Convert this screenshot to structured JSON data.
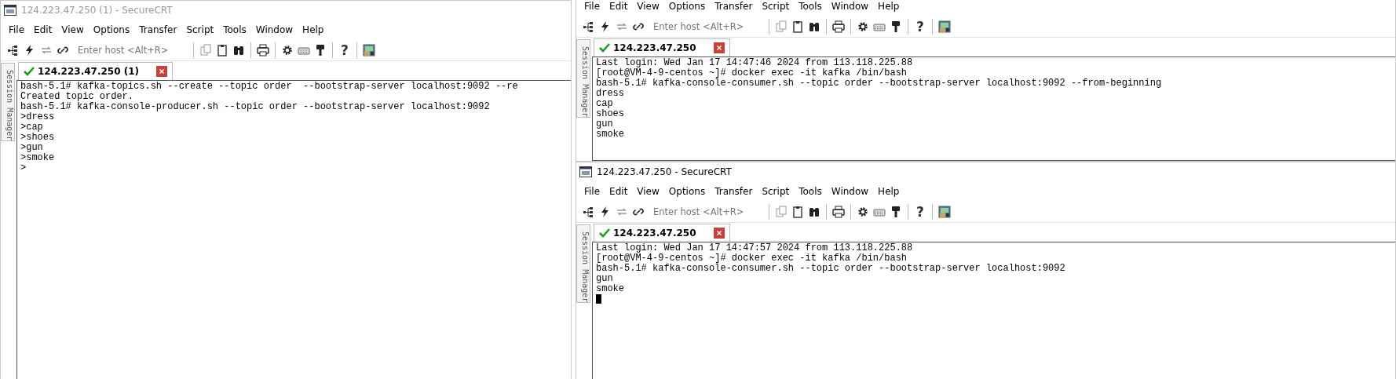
{
  "windows": [
    {
      "title": "124.223.47.250 (1) - SecureCRT",
      "active": false,
      "menu": [
        "File",
        "Edit",
        "View",
        "Options",
        "Transfer",
        "Script",
        "Tools",
        "Window",
        "Help"
      ],
      "toolbar": {
        "host_placeholder": "Enter host <Alt+R>",
        "help_label": "?"
      },
      "side_tab": "Session Manager",
      "tabs": [
        {
          "label": "124.223.47.250 (1)",
          "selected": true,
          "connected": true
        }
      ],
      "terminal": {
        "cursor": false,
        "lines": [
          "bash-5.1# kafka-topics.sh --create --topic order  --bootstrap-server localhost:9092 --re",
          "Created topic order.",
          "bash-5.1# kafka-console-producer.sh --topic order --bootstrap-server localhost:9092",
          ">dress",
          ">cap",
          ">shoes",
          ">gun",
          ">smoke",
          ">"
        ]
      }
    },
    {
      "menu": [
        "File",
        "Edit",
        "View",
        "Options",
        "Transfer",
        "Script",
        "Tools",
        "Window",
        "Help"
      ],
      "toolbar": {
        "host_placeholder": "Enter host <Alt+R>",
        "help_label": "?"
      },
      "side_tab": "Session Manager",
      "tabs": [
        {
          "label": "124.223.47.250",
          "selected": true,
          "connected": true
        }
      ],
      "terminal": {
        "cursor": false,
        "lines": [
          "Last login: Wed Jan 17 14:47:46 2024 from 113.118.225.88",
          "[root@VM-4-9-centos ~]# docker exec -it kafka /bin/bash",
          "bash-5.1# kafka-console-consumer.sh --topic order --bootstrap-server localhost:9092 --from-beginning",
          "dress",
          "cap",
          "shoes",
          "gun",
          "smoke"
        ]
      }
    },
    {
      "title": "124.223.47.250 - SecureCRT",
      "active": true,
      "menu": [
        "File",
        "Edit",
        "View",
        "Options",
        "Transfer",
        "Script",
        "Tools",
        "Window",
        "Help"
      ],
      "toolbar": {
        "host_placeholder": "Enter host <Alt+R>",
        "help_label": "?"
      },
      "side_tab": "Session Manager",
      "tabs": [
        {
          "label": "124.223.47.250",
          "selected": true,
          "connected": true
        }
      ],
      "terminal": {
        "cursor": true,
        "lines": [
          "Last login: Wed Jan 17 14:47:57 2024 from 113.118.225.88",
          "[root@VM-4-9-centos ~]# docker exec -it kafka /bin/bash",
          "bash-5.1# kafka-console-consumer.sh --topic order --bootstrap-server localhost:9092",
          "gun",
          "smoke"
        ]
      }
    }
  ]
}
